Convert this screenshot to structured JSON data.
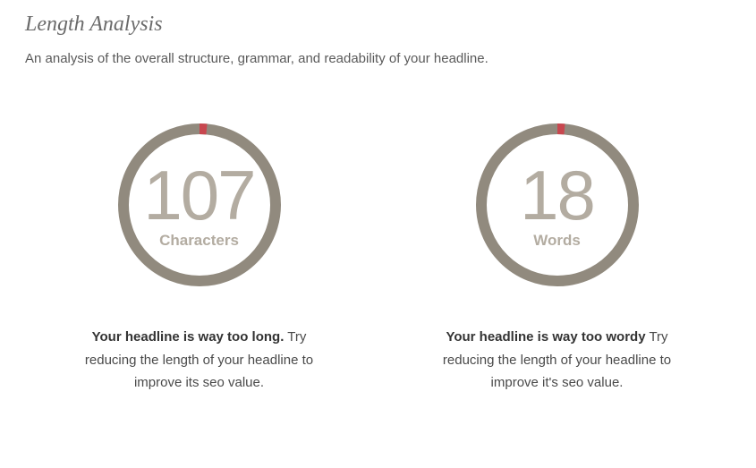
{
  "section": {
    "title": "Length Analysis",
    "description": "An analysis of the overall structure, grammar, and readability of your headline."
  },
  "metrics": {
    "characters": {
      "value": "107",
      "label": "Characters",
      "msg_bold": "Your headline is way too long.",
      "msg_rest": " Try reducing the length of your headline to improve its seo value."
    },
    "words": {
      "value": "18",
      "label": "Words",
      "msg_bold": "Your headline is way too wordy",
      "msg_rest": " Try reducing the length of your headline to improve it's seo value."
    }
  },
  "colors": {
    "ring": "#918a7e",
    "accent": "#c8474f",
    "muted": "#b3aca1"
  }
}
